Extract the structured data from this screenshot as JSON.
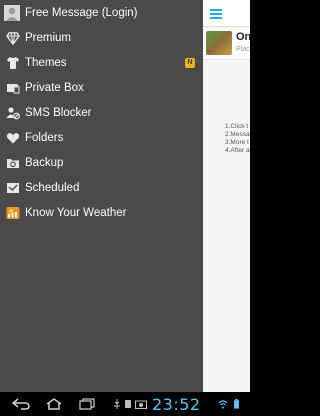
{
  "drawer": {
    "items": [
      {
        "label": "Free Message (Login)",
        "icon": "avatar-icon"
      },
      {
        "label": "Premium",
        "icon": "diamond-icon"
      },
      {
        "label": "Themes",
        "icon": "tshirt-icon",
        "badge": "N"
      },
      {
        "label": "Private Box",
        "icon": "lock-box-icon"
      },
      {
        "label": "SMS Blocker",
        "icon": "blocked-user-icon"
      },
      {
        "label": "Folders",
        "icon": "heart-icon"
      },
      {
        "label": "Backup",
        "icon": "backup-icon"
      },
      {
        "label": "Scheduled",
        "icon": "scheduled-icon"
      },
      {
        "label": "Know Your Weather",
        "icon": "weather-icon"
      }
    ]
  },
  "content": {
    "app_title": "On",
    "app_subtitle": "Plac",
    "instructions": [
      "1.Click t",
      "2.Messa",
      "3.More t",
      "4.After a"
    ]
  },
  "status_bar": {
    "time": "23:52"
  },
  "colors": {
    "drawer_bg": "#4a4a4a",
    "accent": "#29a9e1",
    "badge": "#e7b520",
    "clock": "#5ec6f0"
  }
}
